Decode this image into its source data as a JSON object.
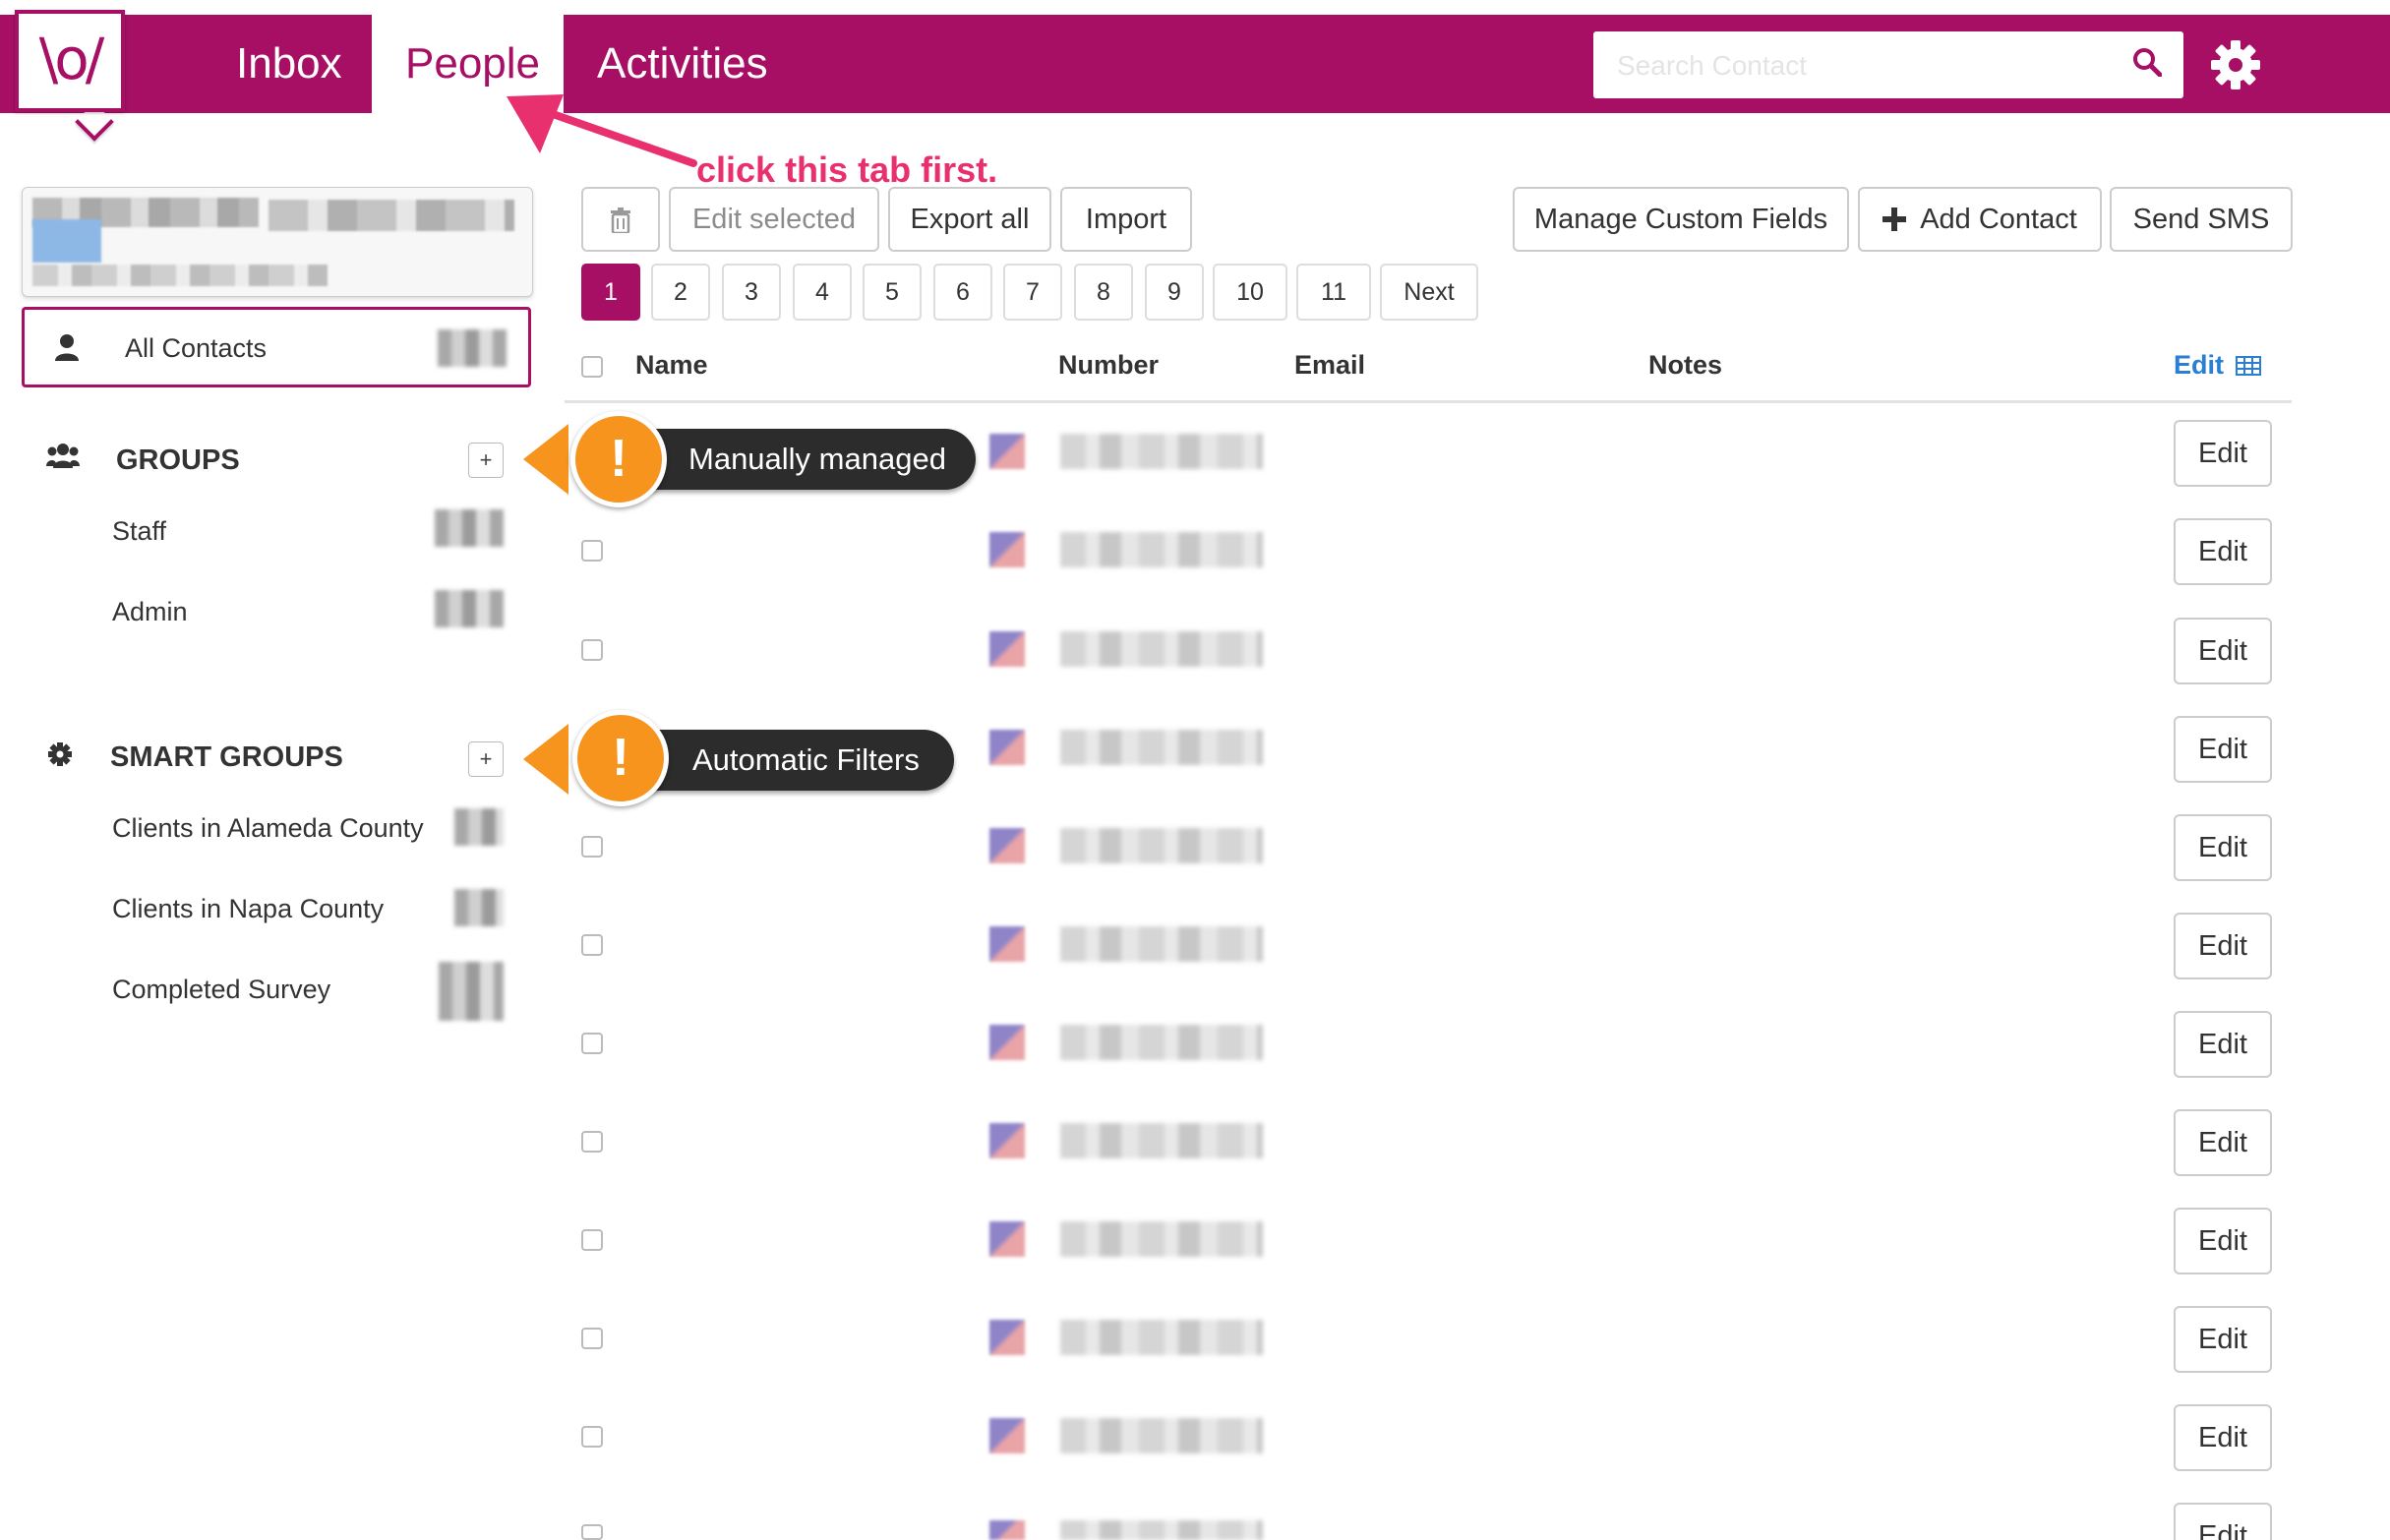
{
  "nav": {
    "logo_text": "\\o/",
    "tabs": [
      {
        "label": "Inbox",
        "active": false
      },
      {
        "label": "People",
        "active": true
      },
      {
        "label": "Activities",
        "active": false
      }
    ],
    "search_placeholder": "Search Contact"
  },
  "annotation": {
    "text": "click this tab first."
  },
  "sidebar": {
    "all_contacts_label": "All Contacts",
    "groups_heading": "GROUPS",
    "groups": [
      {
        "label": "Staff"
      },
      {
        "label": "Admin"
      }
    ],
    "smart_groups_heading": "SMART GROUPS",
    "smart_groups": [
      {
        "label": "Clients in Alameda County"
      },
      {
        "label": "Clients in Napa County"
      },
      {
        "label": "Completed Survey"
      }
    ],
    "add_label": "+"
  },
  "callouts": {
    "groups": "Manually managed",
    "smart_groups": "Automatic Filters",
    "badge": "!"
  },
  "toolbar": {
    "edit_selected": "Edit selected",
    "export_all": "Export all",
    "import": "Import",
    "manage_custom_fields": "Manage Custom Fields",
    "add_contact": "Add Contact",
    "send_sms": "Send SMS"
  },
  "pagination": {
    "pages": [
      "1",
      "2",
      "3",
      "4",
      "5",
      "6",
      "7",
      "8",
      "9",
      "10",
      "11"
    ],
    "active_page": "1",
    "next_label": "Next"
  },
  "table": {
    "columns": {
      "name": "Name",
      "number": "Number",
      "email": "Email",
      "notes": "Notes",
      "edit": "Edit"
    },
    "row_edit_label": "Edit",
    "row_count": 12
  },
  "colors": {
    "brand": "#a70f65",
    "annotation": "#e8306e",
    "callout_orange": "#f7941d",
    "link_blue": "#2a7fd4"
  }
}
